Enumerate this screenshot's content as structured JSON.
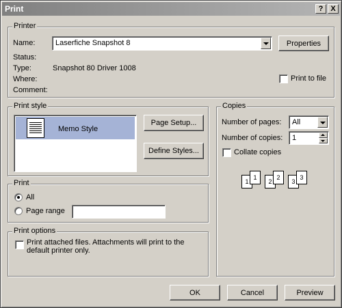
{
  "window": {
    "title": "Print",
    "help_glyph": "?",
    "close_glyph": "X"
  },
  "printer": {
    "group_label": "Printer",
    "name_label": "Name:",
    "name_value": "Laserfiche Snapshot 8",
    "properties_label": "Properties",
    "status_label": "Status:",
    "type_label": "Type:",
    "type_value": "Snapshot 80 Driver 1008",
    "where_label": "Where:",
    "comment_label": "Comment:",
    "print_to_file_label": "Print to file",
    "print_to_file_checked": false
  },
  "print_style": {
    "group_label": "Print style",
    "items": [
      {
        "label": "Memo Style",
        "selected": true
      }
    ],
    "page_setup_label": "Page Setup...",
    "define_styles_label": "Define Styles..."
  },
  "print_range": {
    "group_label": "Print",
    "all_label": "All",
    "page_range_label": "Page range",
    "selected": "All",
    "page_range_value": ""
  },
  "print_options": {
    "group_label": "Print options",
    "attached_line1": "Print attached files.  Attachments will print to the",
    "attached_line2": "default printer only.",
    "attached_checked": false
  },
  "copies": {
    "group_label": "Copies",
    "num_pages_label": "Number of pages:",
    "num_pages_value": "All",
    "num_copies_label": "Number of copies:",
    "num_copies_value": "1",
    "collate_label": "Collate copies",
    "collate_checked": false,
    "collate_pages": [
      "1",
      "1",
      "2",
      "2",
      "3",
      "3"
    ]
  },
  "buttons": {
    "ok": "OK",
    "cancel": "Cancel",
    "preview": "Preview"
  },
  "colors": {
    "selection": "#a5b3d6",
    "titlebar_start": "#808080",
    "titlebar_end": "#b5b5b5",
    "face": "#d4d0c8"
  }
}
